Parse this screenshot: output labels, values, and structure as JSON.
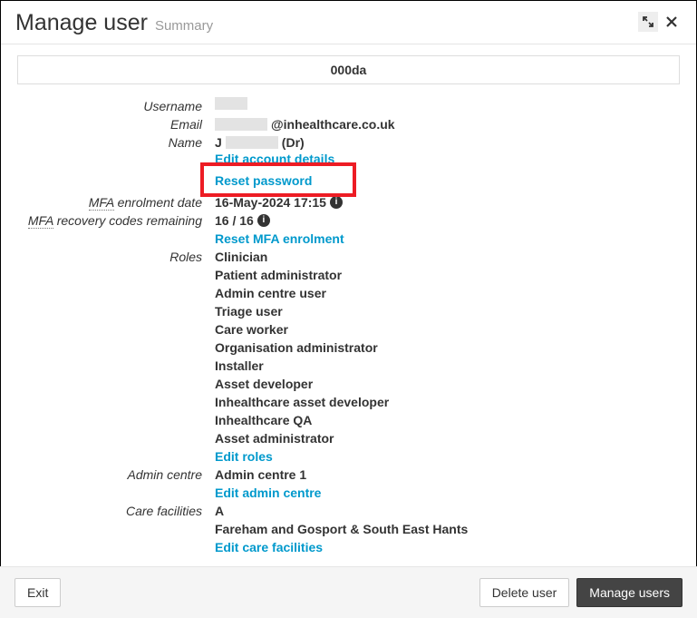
{
  "header": {
    "title": "Manage user",
    "subtitle": "Summary"
  },
  "idbar": "000da",
  "fields": {
    "username_label": "Username",
    "email_label": "Email",
    "email_suffix": "@inhealthcare.co.uk",
    "name_label": "Name",
    "name_prefix": "J",
    "name_suffix": "(Dr)",
    "edit_account": "Edit account details",
    "reset_password": "Reset password",
    "mfa_date_label_prefix": "MFA",
    "mfa_date_label_suffix": " enrolment date",
    "mfa_date": "16-May-2024 17:15",
    "mfa_codes_label_prefix": "MFA",
    "mfa_codes_label_suffix": " recovery codes remaining",
    "mfa_codes": "16 / 16",
    "reset_mfa": "Reset MFA enrolment",
    "roles_label": "Roles",
    "edit_roles": "Edit roles",
    "admin_centre_label": "Admin centre",
    "admin_centre": "Admin centre 1",
    "edit_admin_centre": "Edit admin centre",
    "care_facilities_label": "Care facilities",
    "edit_care_facilities": "Edit care facilities"
  },
  "roles": [
    "Clinician",
    "Patient administrator",
    "Admin centre user",
    "Triage user",
    "Care worker",
    "Organisation administrator",
    "Installer",
    "Asset developer",
    "Inhealthcare asset developer",
    "Inhealthcare QA",
    "Asset administrator"
  ],
  "care_facilities": [
    "A",
    "Fareham and Gosport & South East Hants"
  ],
  "footer": {
    "exit": "Exit",
    "delete": "Delete user",
    "manage": "Manage users"
  }
}
